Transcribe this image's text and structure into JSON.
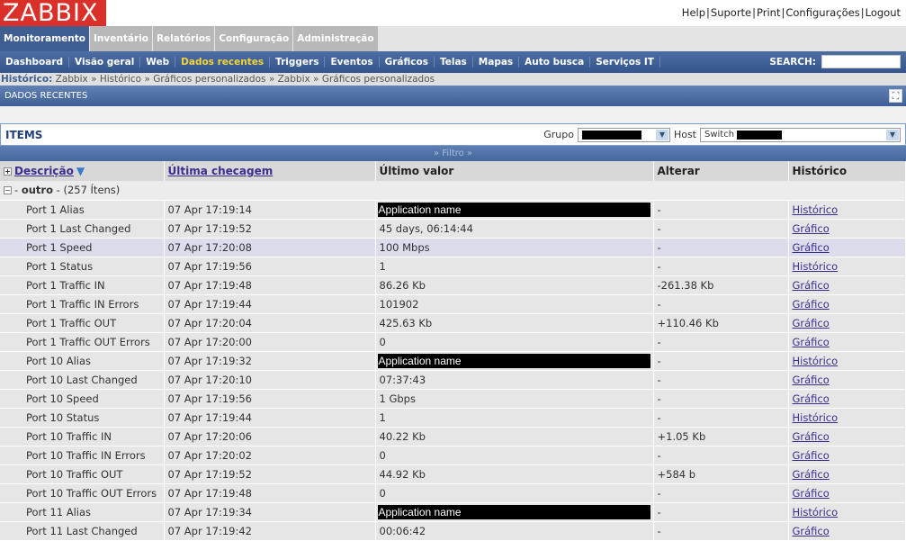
{
  "logo": "ZABBIX",
  "toplinks": [
    "Help",
    "Suporte",
    "Print",
    "Configurações",
    "Logout"
  ],
  "mainmenu": [
    "Monitoramento",
    "Inventário",
    "Relatórios",
    "Configuração",
    "Administração"
  ],
  "submenu": [
    "Dashboard",
    "Visão geral",
    "Web",
    "Dados recentes",
    "Triggers",
    "Eventos",
    "Gráficos",
    "Telas",
    "Mapas",
    "Auto busca",
    "Serviços IT"
  ],
  "search_label": "SEARCH:",
  "breadcrumb": {
    "label": "Histórico:",
    "items": [
      "Zabbix",
      "Histórico",
      "Gráficos personalizados",
      "Zabbix",
      "Gráficos personalizados"
    ]
  },
  "page_title": "DADOS RECENTES",
  "items_title": "ITEMS",
  "filter": {
    "grupo_label": "Grupo",
    "host_label": "Host",
    "host_value": "Switch",
    "toggle": "Filtro"
  },
  "columns": [
    "Descrição",
    "Última checagem",
    "Último valor",
    "Alterar",
    "Histórico"
  ],
  "group": {
    "name": "outro",
    "count": "(257 Ítens)"
  },
  "rows": [
    [
      "Port 1 Alias",
      "07 Apr 17:19:14",
      "Application name",
      "-",
      "Histórico"
    ],
    [
      "Port 1 Last Changed",
      "07 Apr 17:19:52",
      "45 days, 06:14:44",
      "-",
      "Gráfico"
    ],
    [
      "Port 1 Speed",
      "07 Apr 17:20:08",
      "100 Mbps",
      "-",
      "Gráfico"
    ],
    [
      "Port 1 Status",
      "07 Apr 17:19:56",
      "1",
      "-",
      "Histórico"
    ],
    [
      "Port 1 Traffic IN",
      "07 Apr 17:19:48",
      "86.26 Kb",
      "-261.38 Kb",
      "Gráfico"
    ],
    [
      "Port 1 Traffic IN Errors",
      "07 Apr 17:19:44",
      "101902",
      "-",
      "Gráfico"
    ],
    [
      "Port 1 Traffic OUT",
      "07 Apr 17:20:04",
      "425.63 Kb",
      "+110.46 Kb",
      "Gráfico"
    ],
    [
      "Port 1 Traffic OUT Errors",
      "07 Apr 17:20:00",
      "0",
      "-",
      "Gráfico"
    ],
    [
      "Port 10 Alias",
      "07 Apr 17:19:32",
      "Application name",
      "-",
      "Histórico"
    ],
    [
      "Port 10 Last Changed",
      "07 Apr 17:20:10",
      "07:37:43",
      "-",
      "Gráfico"
    ],
    [
      "Port 10 Speed",
      "07 Apr 17:19:56",
      "1 Gbps",
      "-",
      "Gráfico"
    ],
    [
      "Port 10 Status",
      "07 Apr 17:19:44",
      "1",
      "-",
      "Histórico"
    ],
    [
      "Port 10 Traffic IN",
      "07 Apr 17:20:06",
      "40.22 Kb",
      "+1.05 Kb",
      "Gráfico"
    ],
    [
      "Port 10 Traffic IN Errors",
      "07 Apr 17:20:02",
      "0",
      "-",
      "Gráfico"
    ],
    [
      "Port 10 Traffic OUT",
      "07 Apr 17:19:52",
      "44.92 Kb",
      "+584 b",
      "Gráfico"
    ],
    [
      "Port 10 Traffic OUT Errors",
      "07 Apr 17:19:48",
      "0",
      "-",
      "Gráfico"
    ],
    [
      "Port 11 Alias",
      "07 Apr 17:19:34",
      "Application name",
      "-",
      "Histórico"
    ],
    [
      "Port 11 Last Changed",
      "07 Apr 17:19:42",
      "00:06:42",
      "-",
      "Gráfico"
    ]
  ]
}
